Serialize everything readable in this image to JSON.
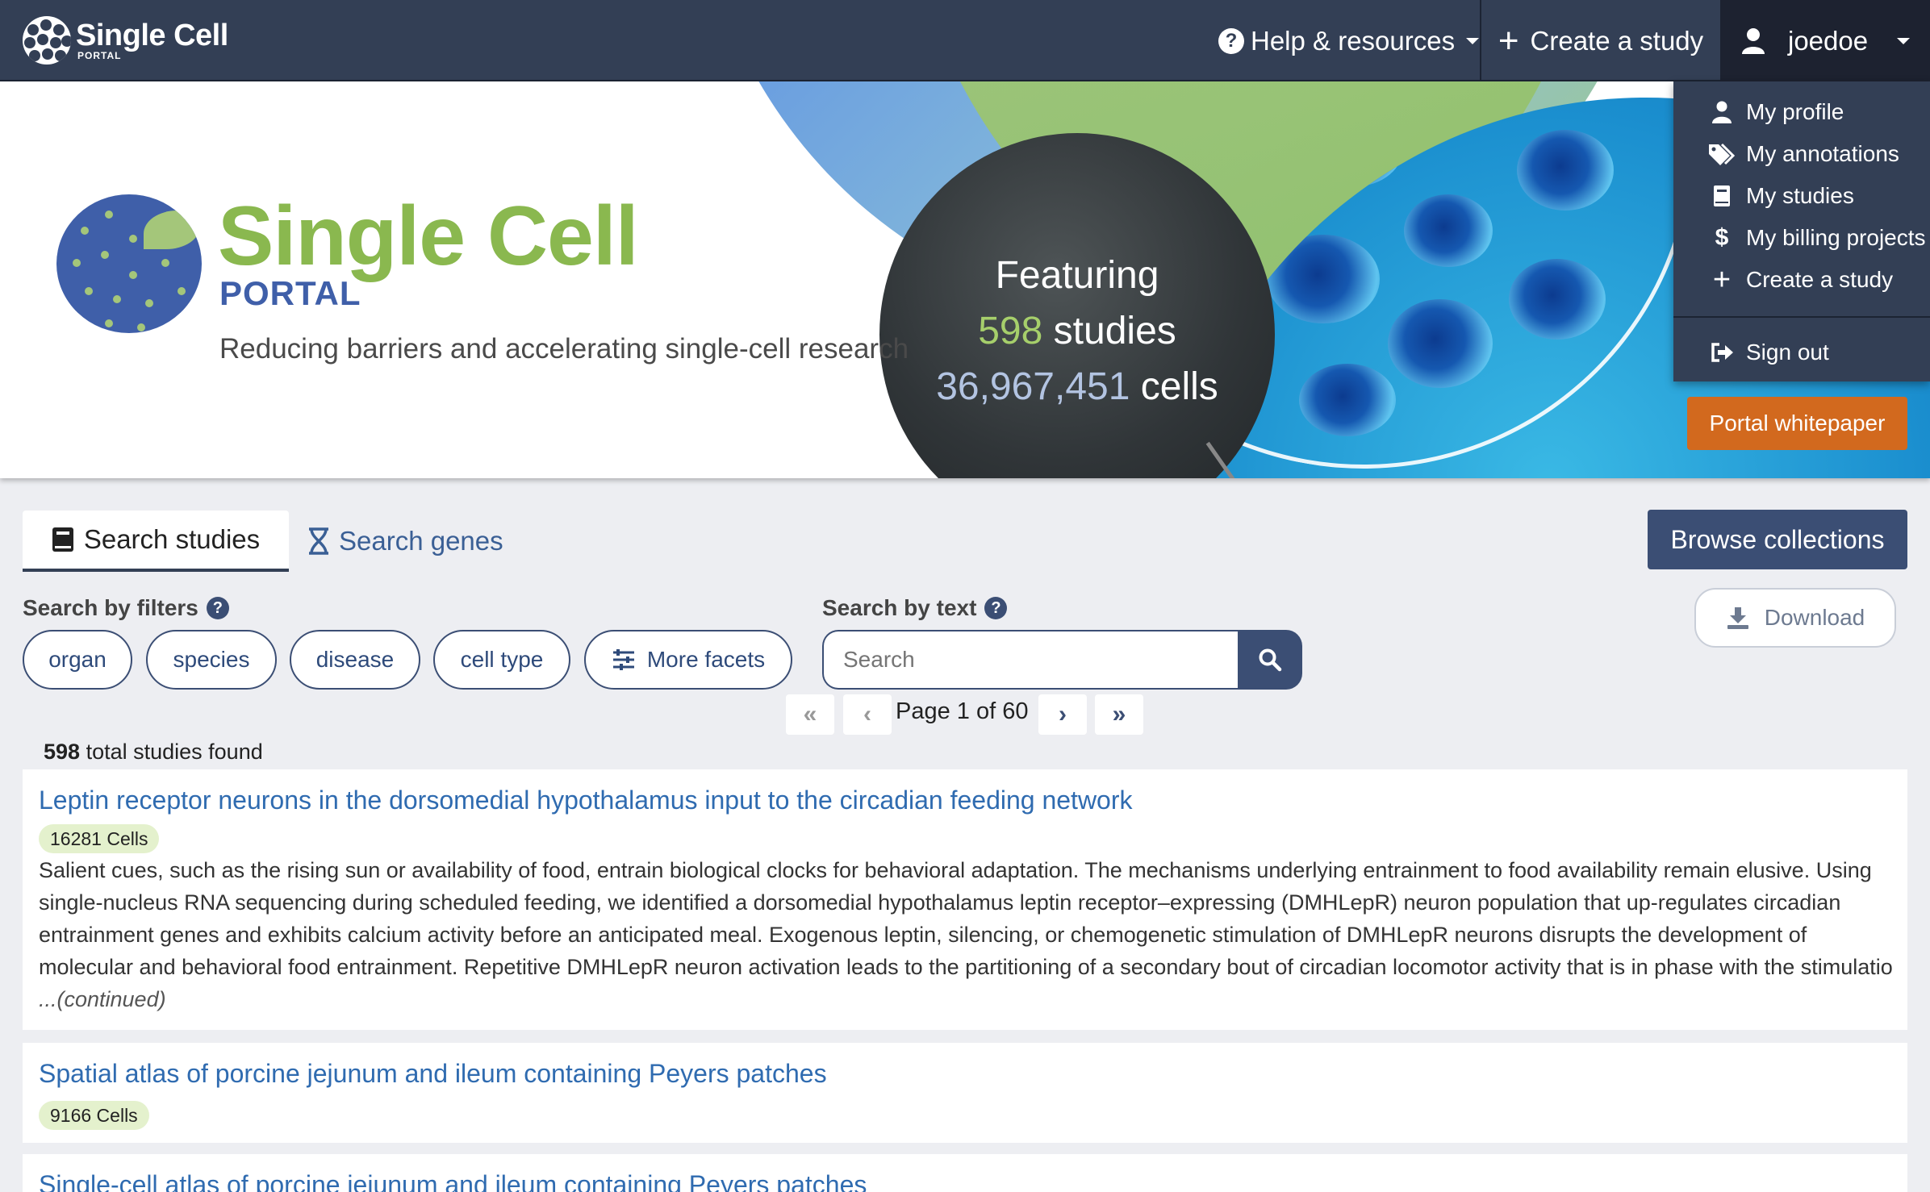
{
  "nav": {
    "brand": "Single Cell",
    "brand_sub": "PORTAL",
    "help": "Help & resources",
    "create": "Create a study",
    "user": "joedoe"
  },
  "user_menu": {
    "items": [
      {
        "label": "My profile",
        "icon": "user-icon"
      },
      {
        "label": "My annotations",
        "icon": "tags-icon"
      },
      {
        "label": "My studies",
        "icon": "book-icon"
      },
      {
        "label": "My billing projects",
        "icon": "dollar-icon"
      },
      {
        "label": "Create a study",
        "icon": "plus-icon"
      }
    ],
    "signout": "Sign out"
  },
  "hero": {
    "title": "Single Cell",
    "subtitle": "PORTAL",
    "tagline": "Reducing barriers and accelerating single-cell research",
    "featuring": "Featuring",
    "studies_count": "598",
    "studies_label": "studies",
    "cells_count": "36,967,451",
    "cells_label": "cells",
    "whitepaper": "Portal whitepaper"
  },
  "tabs": {
    "studies": "Search studies",
    "genes": "Search genes"
  },
  "browse": "Browse collections",
  "download": "Download",
  "filters": {
    "label": "Search by filters",
    "facets": [
      "organ",
      "species",
      "disease",
      "cell type"
    ],
    "more": "More facets"
  },
  "search": {
    "label": "Search by text",
    "placeholder": "Search"
  },
  "pagination": {
    "label": "Page 1 of 60"
  },
  "total": {
    "count": "598",
    "label": "total studies found"
  },
  "results": [
    {
      "title": "Leptin receptor neurons in the dorsomedial hypothalamus input to the circadian feeding network",
      "cells": "16281 Cells",
      "description": "Salient cues, such as the rising sun or availability of food, entrain biological clocks for behavioral adaptation. The mechanisms underlying entrainment to food availability remain elusive. Using single-nucleus RNA sequencing during scheduled feeding, we identified a dorsomedial hypothalamus leptin receptor–expressing (DMHLepR) neuron population that up-regulates circadian entrainment genes and exhibits calcium activity before an anticipated meal. Exogenous leptin, silencing, or chemogenetic stimulation of DMHLepR neurons disrupts the development of molecular and behavioral food entrainment. Repetitive DMHLepR neuron activation leads to the partitioning of a secondary bout of circadian locomotor activity that is in phase with the stimulatio",
      "continued": "...(continued)"
    },
    {
      "title": "Spatial atlas of porcine jejunum and ileum containing Peyers patches",
      "cells": "9166 Cells"
    },
    {
      "title": "Single-cell atlas of porcine jejunum and ileum containing Peyers patches"
    }
  ],
  "colors": {
    "navbar": "#333f55",
    "accent": "#3b4e74",
    "link": "#2f6bb0",
    "brand_green": "#8ab84f",
    "whitepaper": "#d2691e"
  }
}
